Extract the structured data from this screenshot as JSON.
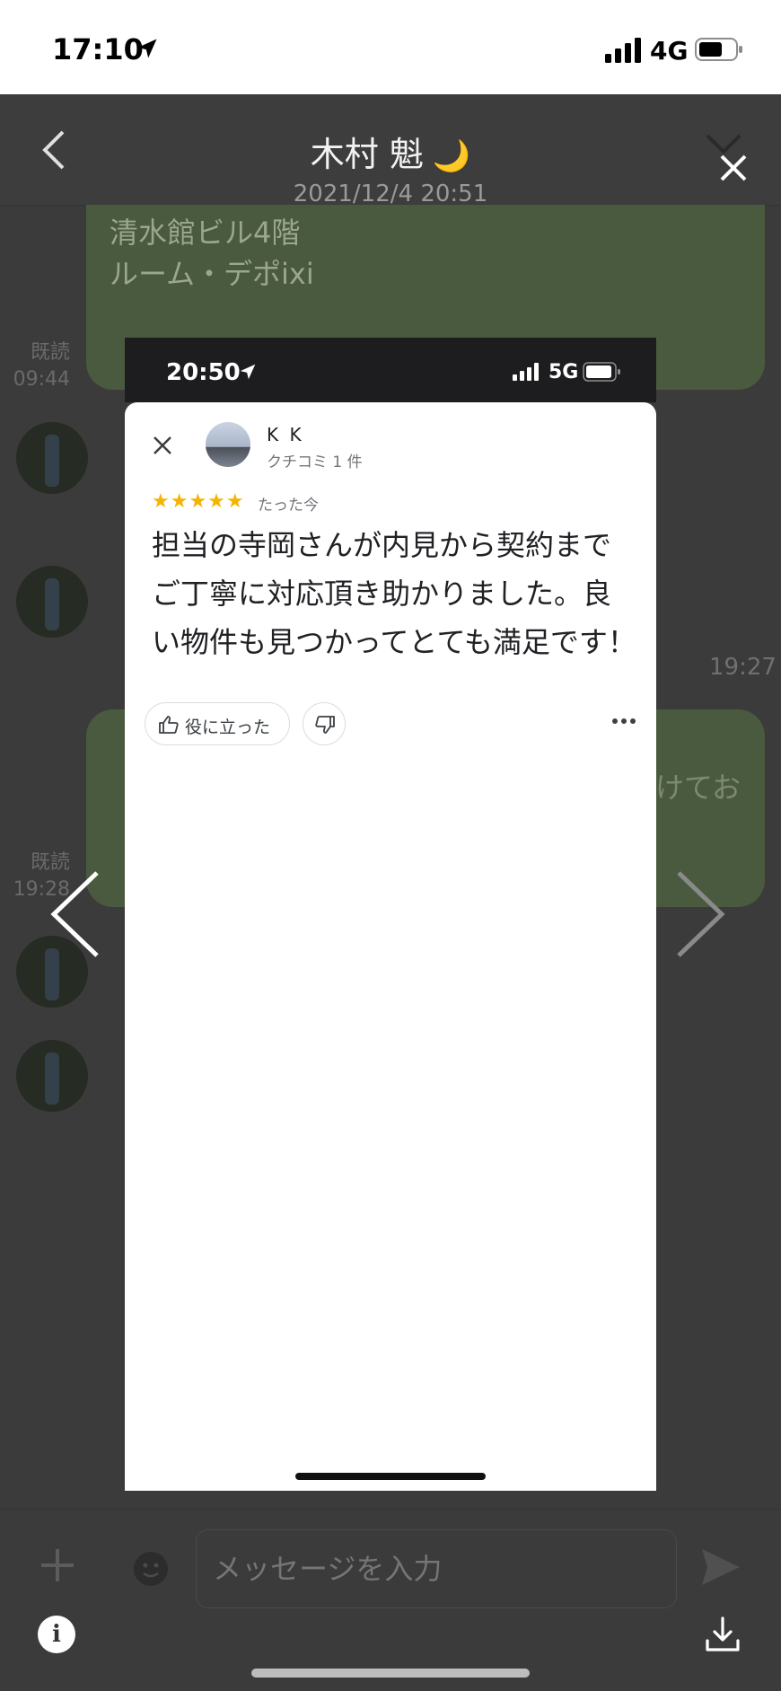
{
  "status_bar": {
    "time": "17:10",
    "network": "4G"
  },
  "header": {
    "title": "木村 魁",
    "title_emoji": "🌙",
    "date": "2021/12/4 20:51"
  },
  "chat_background": {
    "bubble1_lines": [
      "清水館ビル4階",
      "ルーム・デポixi"
    ],
    "read1_label": "既読",
    "read1_time": "09:44",
    "time2": "19:27",
    "read3_label": "既読",
    "read3_time": "19:28",
    "bubble3_fragment": "けてお"
  },
  "preview": {
    "status_time": "20:50",
    "status_network": "5G",
    "review": {
      "user_name": "K K",
      "user_review_count": "クチコミ 1 件",
      "stars": "★★★★★",
      "rating": 5,
      "time_ago": "たった今",
      "text": "担当の寺岡さんが内見から契約までご丁寧に対応頂き助かりました。良い物件も見つかってとても満足です！",
      "helpful_label": "役に立った"
    }
  },
  "composer": {
    "placeholder": "メッセージを入力",
    "info_label": "i"
  },
  "colors": {
    "bubble_green_dim": "#4a5a3e",
    "star_yellow": "#f4b400",
    "overlay_bg": "#3b3b3b"
  }
}
